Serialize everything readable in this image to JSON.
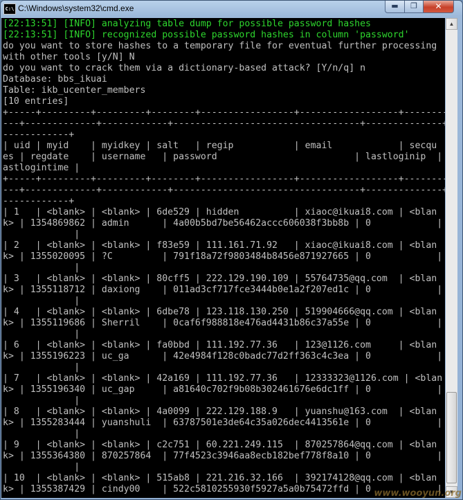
{
  "window": {
    "title": "C:\\Windows\\system32\\cmd.exe",
    "icon": "C:\\",
    "min": "▬",
    "max": "❐",
    "close": "✕"
  },
  "console": {
    "lines": [
      {
        "text": "[22:13:51] [INFO] analyzing table dump for possible password hashes",
        "type": "info"
      },
      {
        "text": "[22:13:51] [INFO] recognized possible password hashes in column 'password'",
        "type": "info"
      },
      {
        "text": "do you want to store hashes to a temporary file for eventual further processing",
        "type": "normal"
      },
      {
        "text": "with other tools [y/N] N",
        "type": "normal"
      },
      {
        "text": "do you want to crack them via a dictionary-based attack? [Y/n/q] n",
        "type": "normal"
      },
      {
        "text": "Database: bbs_ikuai",
        "type": "normal"
      },
      {
        "text": "Table: ikb_ucenter_members",
        "type": "normal"
      },
      {
        "text": "[10 entries]",
        "type": "normal"
      },
      {
        "text": "+-----+---------+---------+--------+-----------------+------------------+---------",
        "type": "normal"
      },
      {
        "text": "---+-------------+------------+----------------------------------+--------------+--",
        "type": "normal"
      },
      {
        "text": "------------+",
        "type": "normal"
      },
      {
        "text": "| uid | myid    | myidkey | salt   | regip           | email            | secqu",
        "type": "normal"
      },
      {
        "text": "es | regdate    | username   | password                         | lastloginip  | l",
        "type": "normal"
      },
      {
        "text": "astlogintime |",
        "type": "normal"
      },
      {
        "text": "+-----+---------+---------+--------+-----------------+------------------+---------",
        "type": "normal"
      },
      {
        "text": "---+-------------+------------+----------------------------------+--------------+--",
        "type": "normal"
      },
      {
        "text": "------------+",
        "type": "normal"
      },
      {
        "text": "| 1   | <blank> | <blank> | 6de529 | hidden          | xiaoc@ikuai8.com | <blan",
        "type": "normal"
      },
      {
        "text": "k> | 1354869862 | admin      | 4a00b5bd7be56462accc606038f3bb8b | 0            | 0",
        "type": "normal"
      },
      {
        "text": "             |",
        "type": "normal"
      },
      {
        "text": "| 2   | <blank> | <blank> | f83e59 | 111.161.71.92   | xiaoc@ikuai8.com | <blan",
        "type": "normal"
      },
      {
        "text": "k> | 1355020095 | ?C         | 791f18a72f9803484b8456e871927665 | 0            | 0",
        "type": "normal"
      },
      {
        "text": "             |",
        "type": "normal"
      },
      {
        "text": "| 3   | <blank> | <blank> | 80cff5 | 222.129.190.109 | 55764735@qq.com  | <blan",
        "type": "normal"
      },
      {
        "text": "k> | 1355118712 | daxiong    | 011ad3cf717fce3444b0e1a2f207ed1c | 0            | 0",
        "type": "normal"
      },
      {
        "text": "             |",
        "type": "normal"
      },
      {
        "text": "| 4   | <blank> | <blank> | 6dbe78 | 123.118.130.250 | 519904666@qq.com | <blan",
        "type": "normal"
      },
      {
        "text": "k> | 1355119686 | Sherril    | 0caf6f988818e476ad4431b86c37a55e | 0            | 0",
        "type": "normal"
      },
      {
        "text": "             |",
        "type": "normal"
      },
      {
        "text": "| 6   | <blank> | <blank> | fa0bbd | 111.192.77.36   | 123@1126.com     | <blan",
        "type": "normal"
      },
      {
        "text": "k> | 1355196223 | uc_ga      | 42e4984f128c0badc77d2ff363c4c3ea | 0            | 0",
        "type": "normal"
      },
      {
        "text": "             |",
        "type": "normal"
      },
      {
        "text": "| 7   | <blank> | <blank> | 42a169 | 111.192.77.36   | 12333323@1126.com | <blan",
        "type": "normal"
      },
      {
        "text": "k> | 1355196340 | uc_gap     | a81640c702f9b08b302461676e6dc1ff | 0            | 0",
        "type": "normal"
      },
      {
        "text": "             |",
        "type": "normal"
      },
      {
        "text": "| 8   | <blank> | <blank> | 4a0099 | 222.129.188.9   | yuanshu@163.com  | <blan",
        "type": "normal"
      },
      {
        "text": "k> | 1355283444 | yuanshuli  | 63787501e3de64c35a026dec4413561e | 0            | 0",
        "type": "normal"
      },
      {
        "text": "             |",
        "type": "normal"
      },
      {
        "text": "| 9   | <blank> | <blank> | c2c751 | 60.221.249.115  | 870257864@qq.com | <blan",
        "type": "normal"
      },
      {
        "text": "k> | 1355364380 | 870257864  | 77f4523c3946aa8ecb182bef778f8a10 | 0            | 0",
        "type": "normal"
      },
      {
        "text": "             |",
        "type": "normal"
      },
      {
        "text": "| 10  | <blank> | <blank> | 515ab8 | 221.216.32.166  | 392174128@qq.com | <blan",
        "type": "normal"
      },
      {
        "text": "k> | 1355387429 | cindy00    | 522c5810255930f5927a5a0b75472ffd | 0            | 0",
        "type": "normal"
      }
    ]
  },
  "scrollbar": {
    "up": "▲",
    "down": "▼"
  },
  "watermark": "www.wooyun.org",
  "colors": {
    "info": "#2ed62e",
    "text": "#c0c0c0",
    "background": "#000000"
  }
}
